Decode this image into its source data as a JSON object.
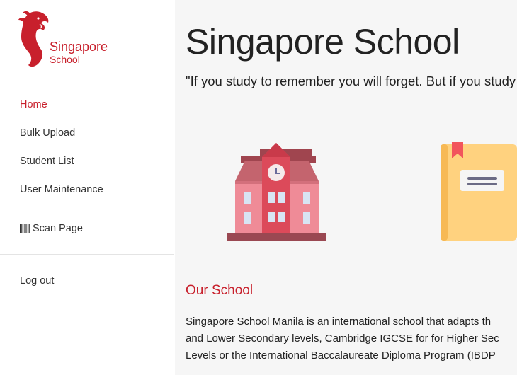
{
  "brand": {
    "name_line1": "Singapore",
    "name_line2": "School",
    "logo_icon": "merlion-logo-icon",
    "color": "#c8202c"
  },
  "nav": {
    "items": [
      {
        "label": "Home",
        "active": true
      },
      {
        "label": "Bulk Upload",
        "active": false
      },
      {
        "label": "Student List",
        "active": false
      },
      {
        "label": "User Maintenance",
        "active": false
      }
    ],
    "scan": {
      "label": "Scan Page",
      "icon": "barcode-icon"
    },
    "logout": "Log out"
  },
  "main": {
    "title": "Singapore School",
    "quote": "\"If you study to remember you will forget. But if you study to understand you will remember.\"",
    "illustrations": [
      "school-building-icon",
      "notebook-icon"
    ],
    "section_title": "Our School",
    "paragraph_lines": [
      "Singapore School Manila is an international school that adapts th",
      "and Lower Secondary levels, Cambridge IGCSE for for Higher Sec",
      "Levels or the International Baccalaureate Diploma Program (IBDP"
    ]
  }
}
